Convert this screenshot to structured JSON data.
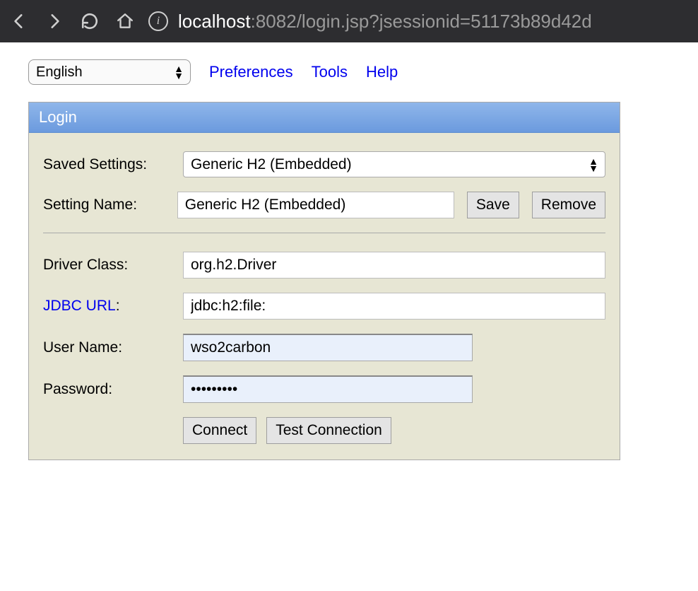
{
  "browser": {
    "url_host": "localhost",
    "url_path": ":8082/login.jsp?jsessionid=51173b89d42d"
  },
  "toolbar": {
    "language": "English",
    "links": {
      "preferences": "Preferences",
      "tools": "Tools",
      "help": "Help"
    }
  },
  "panel": {
    "title": "Login"
  },
  "form": {
    "saved_settings_label": "Saved Settings:",
    "saved_settings_value": "Generic H2 (Embedded)",
    "setting_name_label": "Setting Name:",
    "setting_name_value": "Generic H2 (Embedded)",
    "save_btn": "Save",
    "remove_btn": "Remove",
    "driver_class_label": "Driver Class:",
    "driver_class_value": "org.h2.Driver",
    "jdbc_url_label": "JDBC URL",
    "jdbc_url_colon": ":",
    "jdbc_url_value": "jdbc:h2:file:",
    "user_name_label": "User Name:",
    "user_name_value": "wso2carbon",
    "password_label": "Password:",
    "password_value": "•••••••••",
    "connect_btn": "Connect",
    "test_btn": "Test Connection"
  }
}
